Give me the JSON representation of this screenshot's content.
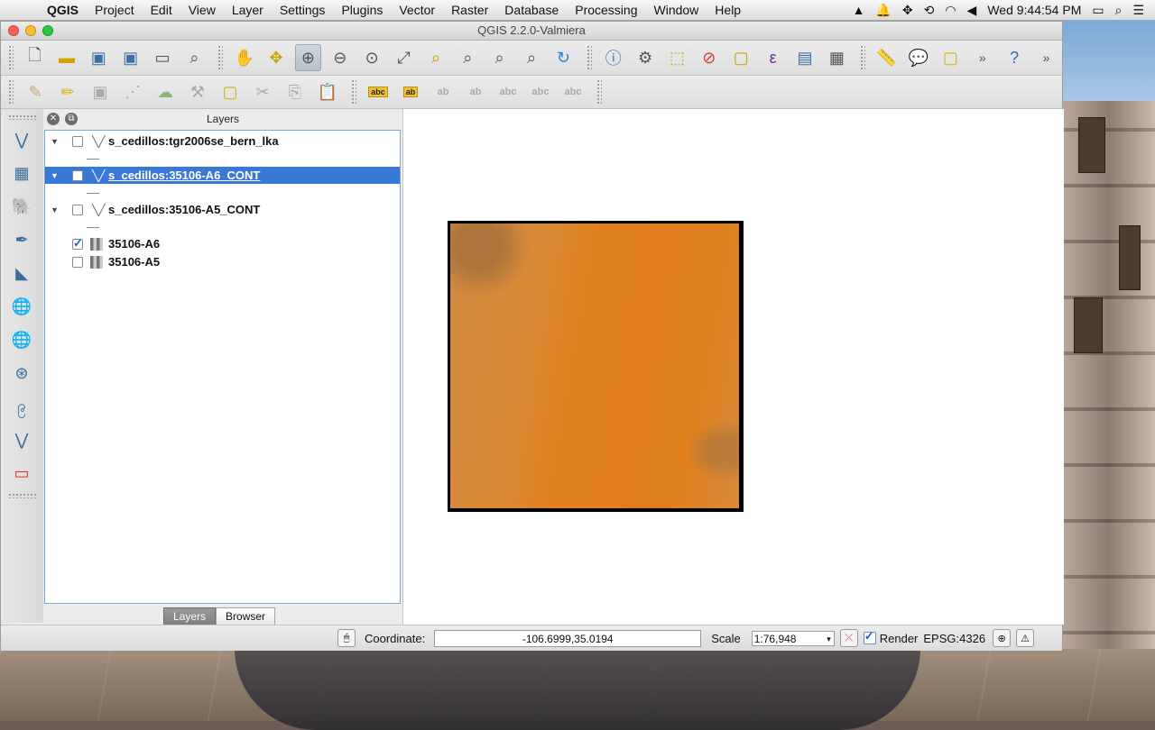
{
  "menubar": {
    "app_name": "QGIS",
    "items": [
      "Project",
      "Edit",
      "View",
      "Layer",
      "Settings",
      "Plugins",
      "Vector",
      "Raster",
      "Database",
      "Processing",
      "Window",
      "Help"
    ],
    "clock": "Wed 9:44:54 PM"
  },
  "window": {
    "title": "QGIS 2.2.0-Valmiera"
  },
  "layers_panel": {
    "title": "Layers",
    "layers": [
      {
        "name": "s_cedillos:tgr2006se_bern_lka",
        "type": "vector",
        "expanded": true,
        "checked": false,
        "selected": false
      },
      {
        "name": "s_cedillos:35106-A6_CONT",
        "type": "vector",
        "expanded": true,
        "checked": false,
        "selected": true
      },
      {
        "name": "s_cedillos:35106-A5_CONT",
        "type": "vector",
        "expanded": true,
        "checked": false,
        "selected": false
      },
      {
        "name": "35106-A6",
        "type": "raster",
        "checked": true,
        "selected": false
      },
      {
        "name": "35106-A5",
        "type": "raster",
        "checked": false,
        "selected": false
      }
    ],
    "tabs": [
      {
        "label": "Layers",
        "active": true
      },
      {
        "label": "Browser",
        "active": false
      }
    ]
  },
  "statusbar": {
    "coordinate_label": "Coordinate:",
    "coordinate_value": "-106.6999,35.0194",
    "scale_label": "Scale",
    "scale_value": "1:76,948",
    "render_label": "Render",
    "render_checked": true,
    "crs": "EPSG:4326"
  },
  "colors": {
    "raster_fill": "#e07f1d",
    "selection": "#3a78d8"
  }
}
